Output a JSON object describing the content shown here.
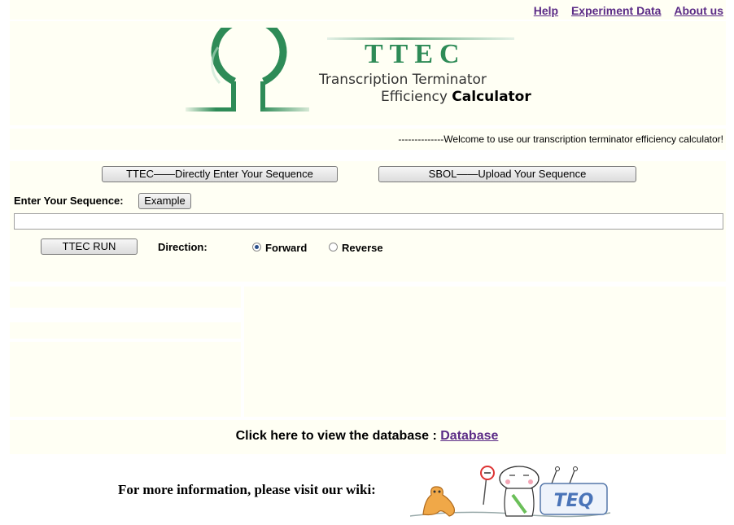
{
  "nav": {
    "help": "Help",
    "experiment_data": "Experiment Data",
    "about_us": "About us"
  },
  "logo": {
    "title": "TTEC",
    "line1": "Transcription Terminator",
    "line2a": "Efficiency",
    "line2b": "Calculator"
  },
  "welcome": "--------------Welcome to use our transcription terminator efficiency calculator!",
  "mode_buttons": {
    "ttec": "TTEC——Directly Enter Your Sequence",
    "sbol": "SBOL——Upload Your Sequence"
  },
  "sequence": {
    "label": "Enter Your Sequence:",
    "example_button": "Example",
    "value": ""
  },
  "run": {
    "button": "TTEC RUN",
    "direction_label": "Direction:",
    "options": [
      "Forward",
      "Reverse"
    ],
    "selected": "Forward"
  },
  "database": {
    "prompt": "Click here to view the database :",
    "link": "Database"
  },
  "wiki": {
    "prompt": "For more information, please visit our wiki:",
    "logo_text": "TEQ"
  },
  "colors": {
    "link": "#5b2b86",
    "logo_green": "#2e8b57",
    "panel": "#fffff4"
  }
}
